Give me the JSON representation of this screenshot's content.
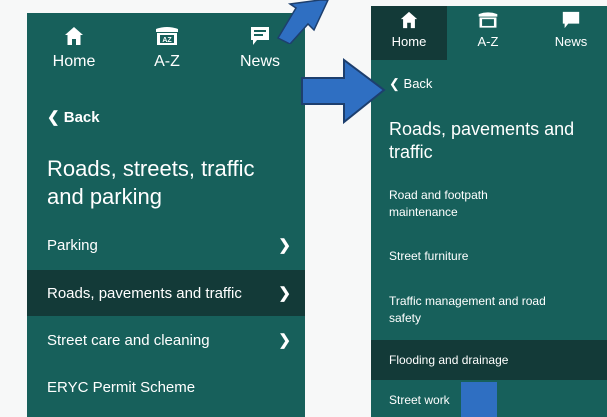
{
  "left_panel": {
    "nav": [
      {
        "label": "Home",
        "icon": "home-icon"
      },
      {
        "label": "A-Z",
        "icon": "az-icon"
      },
      {
        "label": "News",
        "icon": "news-icon"
      }
    ],
    "back_label": "Back",
    "title": "Roads, streets, traffic and parking",
    "items": [
      {
        "label": "Parking",
        "selected": false
      },
      {
        "label": "Roads, pavements and traffic",
        "selected": true
      },
      {
        "label": "Street care and cleaning",
        "selected": false
      },
      {
        "label": "ERYC Permit Scheme",
        "selected": false
      }
    ]
  },
  "right_panel": {
    "nav": [
      {
        "label": "Home",
        "icon": "home-icon"
      },
      {
        "label": "A-Z",
        "icon": "az-icon"
      },
      {
        "label": "News",
        "icon": "news-icon"
      }
    ],
    "back_label": "Back",
    "title": "Roads, pavements and traffic",
    "items": [
      {
        "label": "Road and footpath maintenance"
      },
      {
        "label": "Street furniture"
      },
      {
        "label": "Traffic management and road safety"
      },
      {
        "label": "Flooding and drainage"
      },
      {
        "label": "Street work"
      }
    ]
  },
  "colors": {
    "panel_bg": "#17605b",
    "selected_bg": "#133a38",
    "arrow_blue": "#2f6fc2"
  }
}
